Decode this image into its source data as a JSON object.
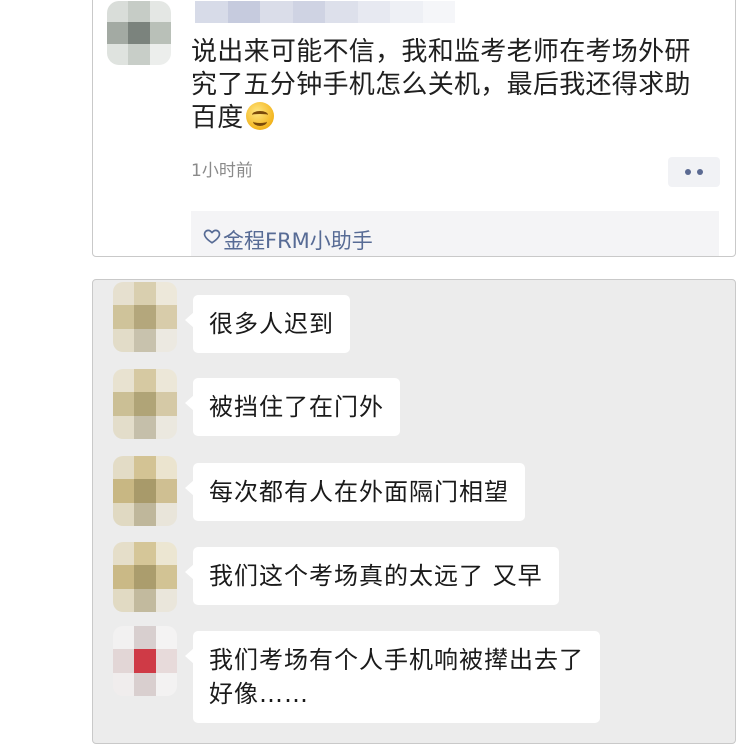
{
  "post": {
    "text": "说出来可能不信，我和监考老师在考场外研究了五分钟手机怎么关机，最后我还得求助百度",
    "emoji": "grinning-face-emoji",
    "time": "1小时前",
    "liked_by": "金程FRM小助手"
  },
  "chat": {
    "messages": [
      {
        "text": "很多人迟到"
      },
      {
        "text": "被挡住了在门外"
      },
      {
        "text": "每次都有人在外面隔门相望"
      },
      {
        "text": "我们这个考场真的太远了 又早"
      },
      {
        "line1": "我们考场有个人手机响被撵出去了",
        "line2": "好像……"
      }
    ]
  },
  "colors": {
    "link_blue": "#576b95",
    "chat_bg": "#ececec",
    "bubble_bg": "#ffffff",
    "time_gray": "#8a8a8a"
  },
  "icons": {
    "more": "more-dots-icon",
    "like": "heart-outline-icon"
  }
}
